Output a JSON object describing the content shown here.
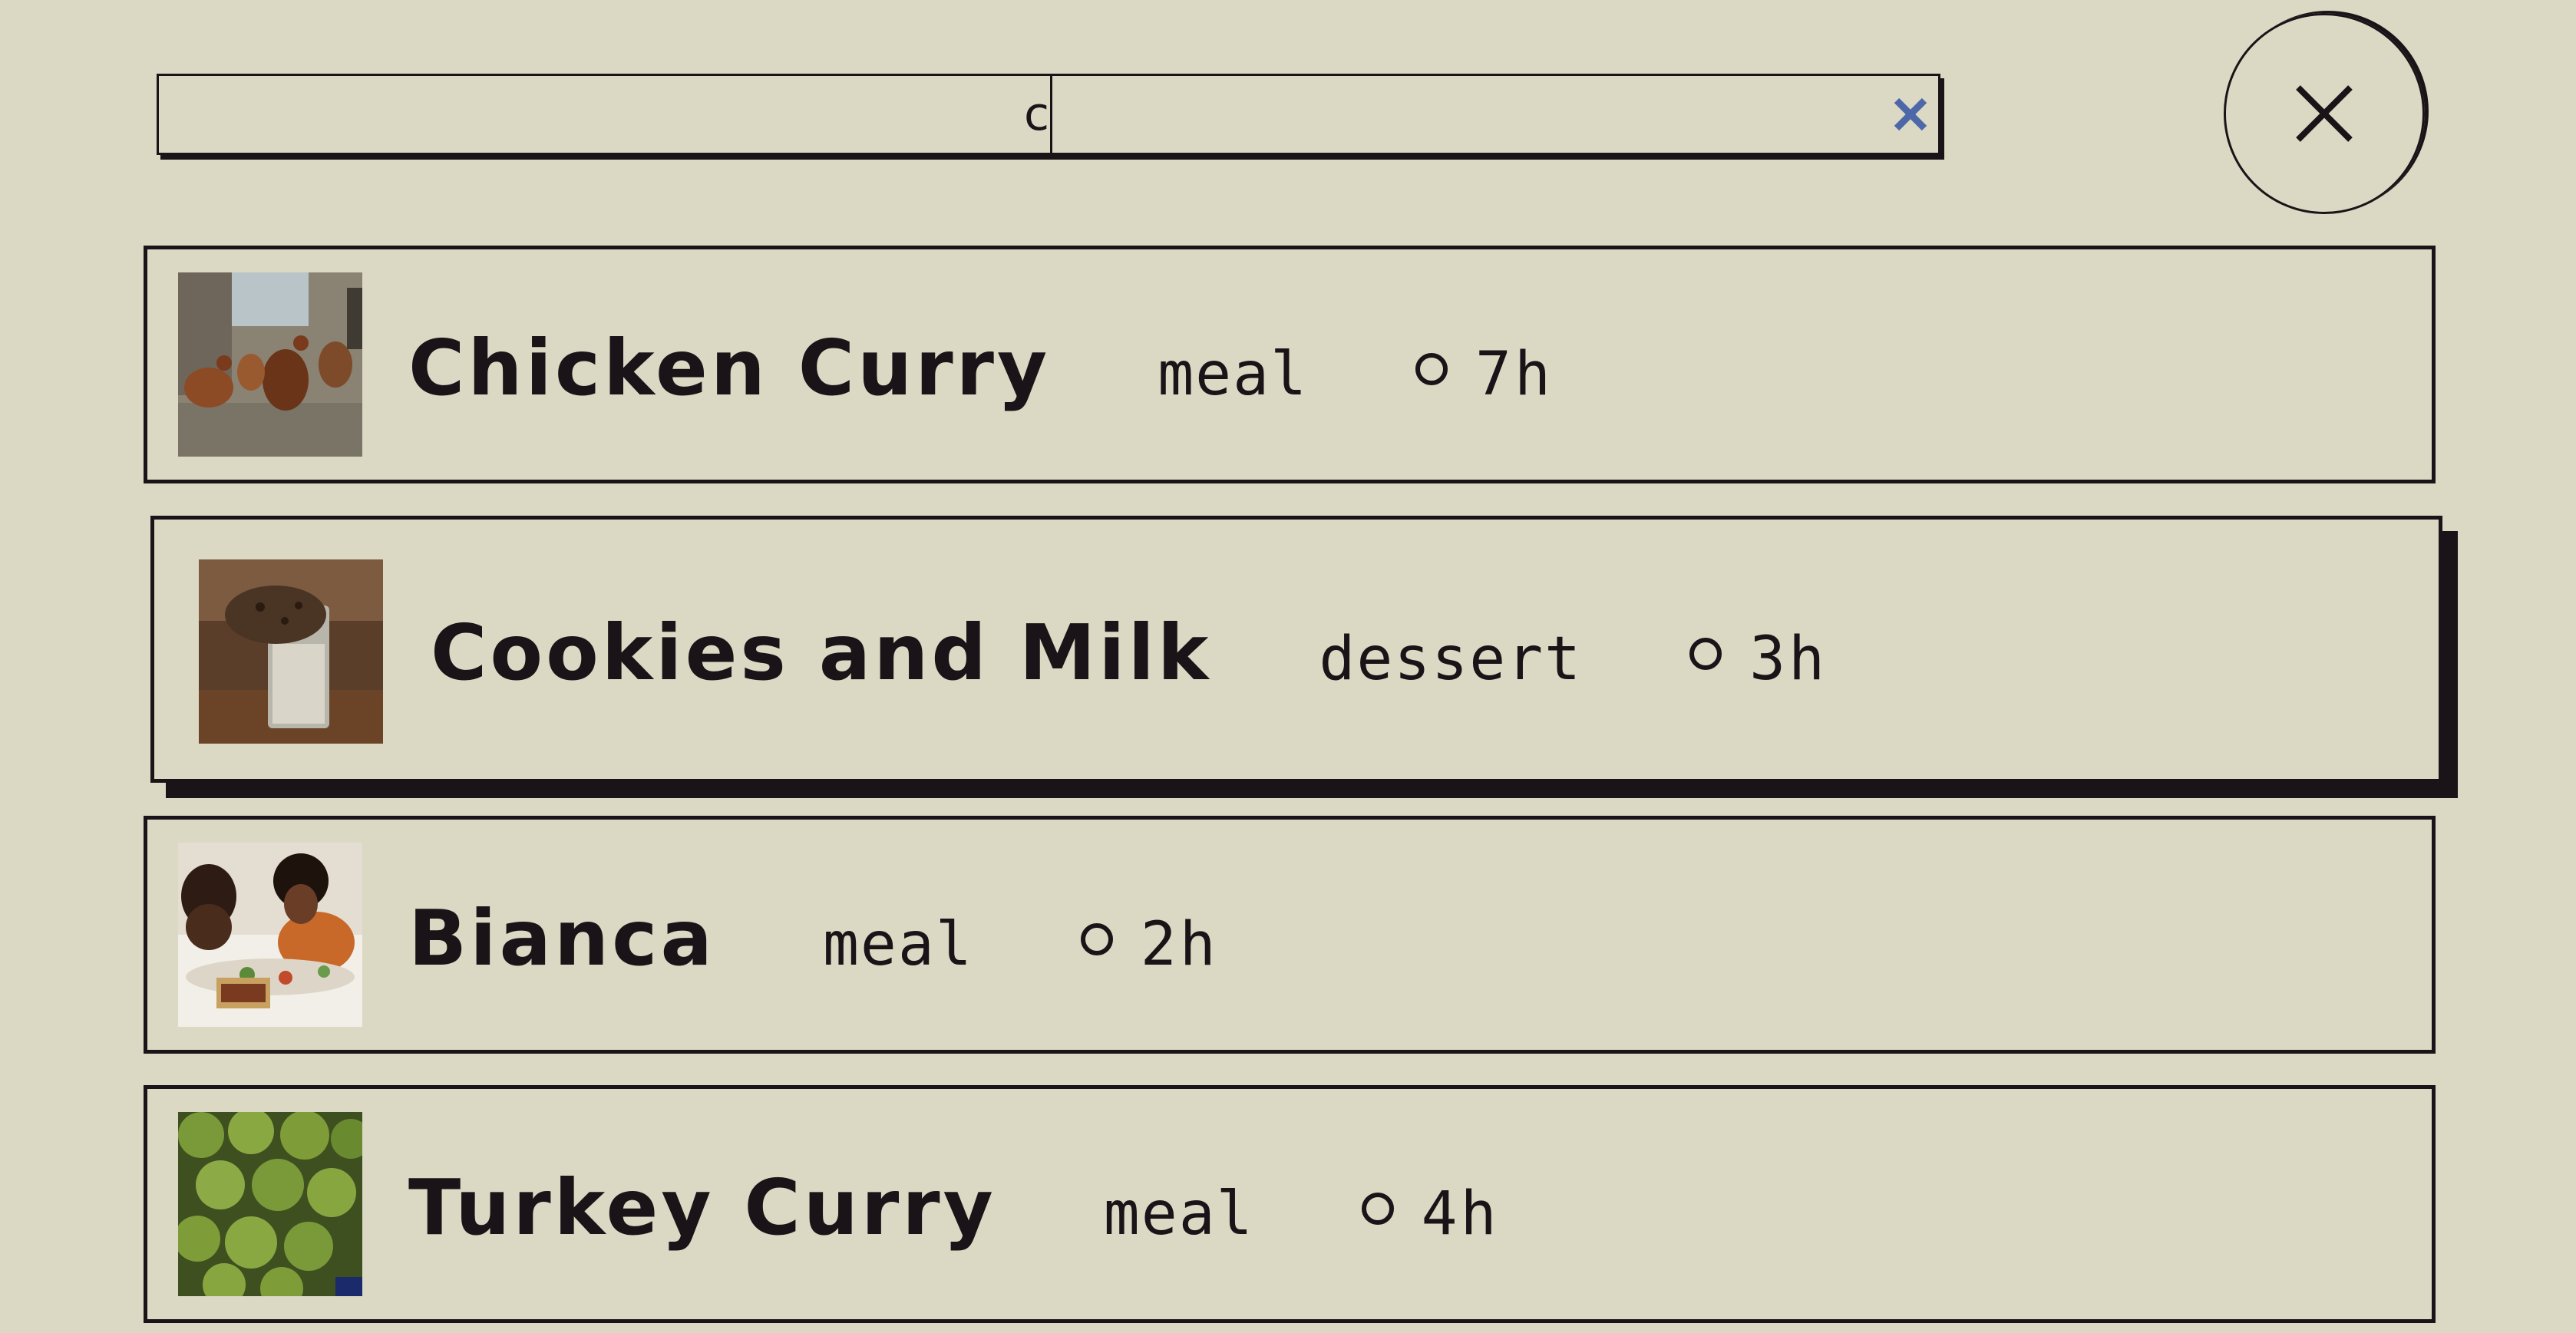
{
  "search": {
    "value": "c",
    "clear_icon": "close-x-icon",
    "clear_icon_color": "#4c68a8"
  },
  "close_button": {
    "icon": "close-icon"
  },
  "colors": {
    "background": "#dbd8c4",
    "ink": "#1a1418"
  },
  "results": [
    {
      "title": "Chicken Curry",
      "category": "meal",
      "duration": "7h",
      "thumbnail": "chickens-photo",
      "active": false
    },
    {
      "title": "Cookies and Milk",
      "category": "dessert",
      "duration": "3h",
      "thumbnail": "cookie-milk-photo",
      "active": true
    },
    {
      "title": "Bianca",
      "category": "meal",
      "duration": "2h",
      "thumbnail": "family-dinner-photo",
      "active": false
    },
    {
      "title": "Turkey Curry",
      "category": "meal",
      "duration": "4h",
      "thumbnail": "artichokes-photo",
      "active": false
    }
  ]
}
